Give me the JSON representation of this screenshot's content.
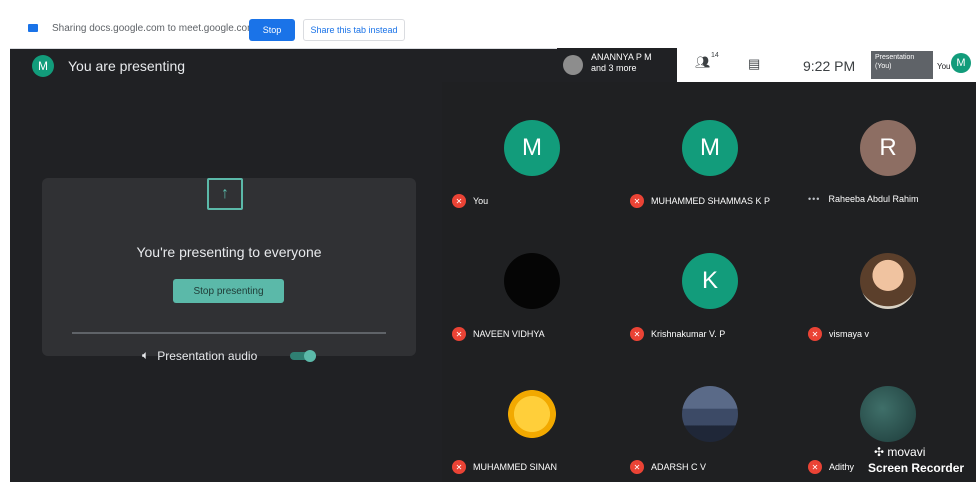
{
  "sharebar": {
    "sharing_text": "Sharing docs.google.com to meet.google.com",
    "stop_label": "Stop",
    "share_tab_label": "Share this tab instead"
  },
  "presenting": {
    "avatar_initial": "M",
    "title": "You are presenting",
    "message": "You're presenting to everyone",
    "stop_presenting_label": "Stop presenting",
    "audio_label": "Presentation audio",
    "audio_enabled": true
  },
  "topbar": {
    "viewer_name": "ANANNYA P M",
    "viewer_more": "and 3 more",
    "people_count": "14",
    "time": "9:22 PM",
    "presentation_tile_text": "Presentation (You)",
    "you_label": "You",
    "self_initial": "M"
  },
  "participants": [
    {
      "name": "You",
      "initial": "M",
      "color": "#129c7b",
      "status": "muted"
    },
    {
      "name": "MUHAMMED SHAMMAS K P",
      "initial": "M",
      "color": "#129c7b",
      "status": "muted"
    },
    {
      "name": "Raheeba Abdul Rahim",
      "initial": "R",
      "color": "#8d6e63",
      "status": "more"
    },
    {
      "name": "NAVEEN VIDHYA",
      "initial": "",
      "color": "#050505",
      "status": "muted"
    },
    {
      "name": "Krishnakumar V. P",
      "initial": "K",
      "color": "#129c7b",
      "status": "muted"
    },
    {
      "name": "vismaya v",
      "initial": "",
      "color": "#d9d2c4",
      "status": "muted"
    },
    {
      "name": "MUHAMMED SINAN",
      "initial": "",
      "color": "#f2a900",
      "status": "muted"
    },
    {
      "name": "ADARSH C V",
      "initial": "",
      "color": "#5a6a88",
      "status": "muted"
    },
    {
      "name": "Adithy",
      "initial": "",
      "color": "#2c5552",
      "status": "muted"
    }
  ],
  "watermark": {
    "brand": "movavi",
    "product": "Screen Recorder"
  }
}
